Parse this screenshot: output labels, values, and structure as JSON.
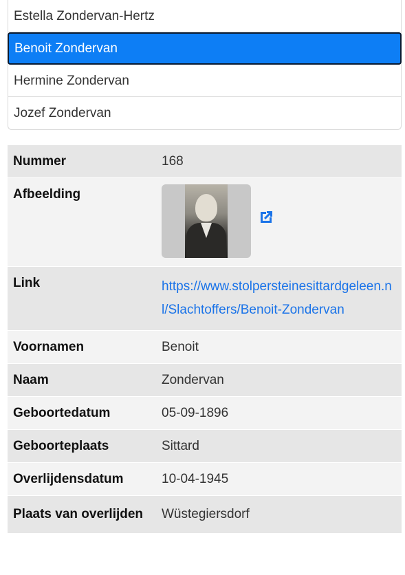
{
  "people_list": [
    {
      "name": "Estella Zondervan-Hertz"
    },
    {
      "name": "Benoit Zondervan"
    },
    {
      "name": "Hermine Zondervan"
    },
    {
      "name": "Jozef Zondervan"
    }
  ],
  "details": {
    "nummer_label": "Nummer",
    "nummer_value": "168",
    "afbeelding_label": "Afbeelding",
    "link_label": "Link",
    "link_value": "https://www.stolpersteinesittardgeleen.nl/Slachtoffers/Benoit-Zondervan",
    "voornamen_label": "Voornamen",
    "voornamen_value": "Benoit",
    "naam_label": "Naam",
    "naam_value": "Zondervan",
    "geboortedatum_label": "Geboortedatum",
    "geboortedatum_value": "05-09-1896",
    "geboorteplaats_label": "Geboorteplaats",
    "geboorteplaats_value": "Sittard",
    "overlijdensdatum_label": "Overlijdensdatum",
    "overlijdensdatum_value": "10-04-1945",
    "plaats_overlijden_label": "Plaats van overlijden",
    "plaats_overlijden_value": "Wüstegiersdorf"
  },
  "icons": {
    "external_link": "external-link-icon"
  },
  "colors": {
    "selected_bg": "#0d7ef5",
    "link": "#1a73e8"
  }
}
